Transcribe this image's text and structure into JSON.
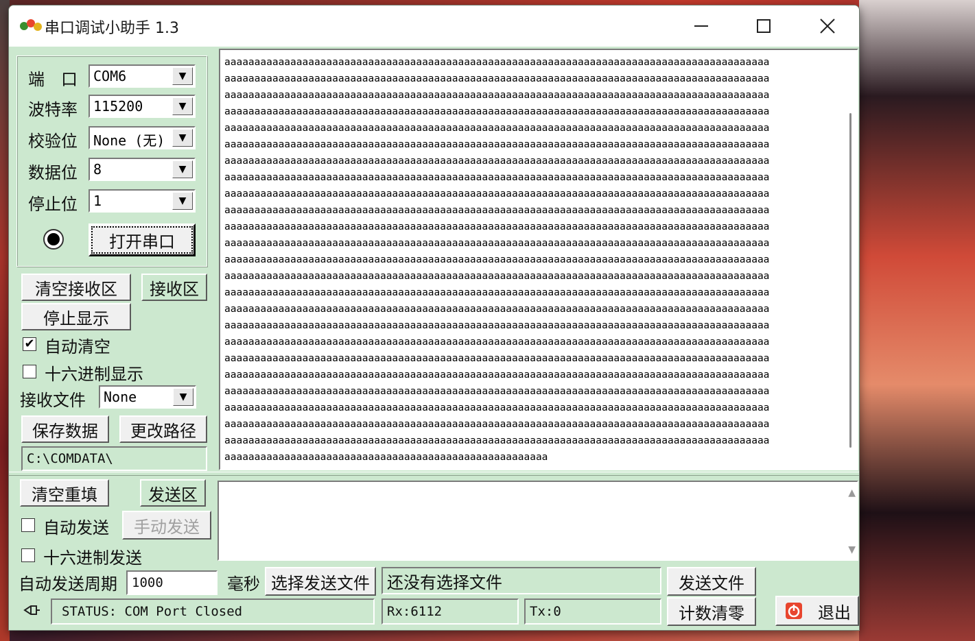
{
  "window": {
    "title": "串口调试小助手 1.3"
  },
  "settings": {
    "port_label": "端　口",
    "port_value": "COM6",
    "baud_label": "波特率",
    "baud_value": "115200",
    "parity_label": "校验位",
    "parity_value": "None (无)",
    "databits_label": "数据位",
    "databits_value": "8",
    "stopbits_label": "停止位",
    "stopbits_value": "1",
    "open_port_label": "打开串口"
  },
  "receive": {
    "clear_label": "清空接收区",
    "area_label": "接收区",
    "stop_display_label": "停止显示",
    "auto_clear_label": "自动清空",
    "auto_clear_checked": true,
    "hex_display_label": "十六进制显示",
    "hex_display_checked": false,
    "file_label": "接收文件",
    "file_value": "None",
    "save_label": "保存数据",
    "change_path_label": "更改路径",
    "path_value": "C:\\COMDATA\\",
    "lines": [
      "aaaaaaaaaaaaaaaaaaaaaaaaaaaaaaaaaaaaaaaaaaaaaaaaaaaaaaaaaaaaaaaaaaaaaaaaaaaaaaaaaaaaaaaaaaa",
      "aaaaaaaaaaaaaaaaaaaaaaaaaaaaaaaaaaaaaaaaaaaaaaaaaaaaaaaaaaaaaaaaaaaaaaaaaaaaaaaaaaaaaaaaaaa",
      "aaaaaaaaaaaaaaaaaaaaaaaaaaaaaaaaaaaaaaaaaaaaaaaaaaaaaaaaaaaaaaaaaaaaaaaaaaaaaaaaaaaaaaaaaaa",
      "aaaaaaaaaaaaaaaaaaaaaaaaaaaaaaaaaaaaaaaaaaaaaaaaaaaaaaaaaaaaaaaaaaaaaaaaaaaaaaaaaaaaaaaaaaa",
      "aaaaaaaaaaaaaaaaaaaaaaaaaaaaaaaaaaaaaaaaaaaaaaaaaaaaaaaaaaaaaaaaaaaaaaaaaaaaaaaaaaaaaaaaaaa",
      "aaaaaaaaaaaaaaaaaaaaaaaaaaaaaaaaaaaaaaaaaaaaaaaaaaaaaaaaaaaaaaaaaaaaaaaaaaaaaaaaaaaaaaaaaaa",
      "aaaaaaaaaaaaaaaaaaaaaaaaaaaaaaaaaaaaaaaaaaaaaaaaaaaaaaaaaaaaaaaaaaaaaaaaaaaaaaaaaaaaaaaaaaa",
      "aaaaaaaaaaaaaaaaaaaaaaaaaaaaaaaaaaaaaaaaaaaaaaaaaaaaaaaaaaaaaaaaaaaaaaaaaaaaaaaaaaaaaaaaaaa",
      "aaaaaaaaaaaaaaaaaaaaaaaaaaaaaaaaaaaaaaaaaaaaaaaaaaaaaaaaaaaaaaaaaaaaaaaaaaaaaaaaaaaaaaaaaaa",
      "aaaaaaaaaaaaaaaaaaaaaaaaaaaaaaaaaaaaaaaaaaaaaaaaaaaaaaaaaaaaaaaaaaaaaaaaaaaaaaaaaaaaaaaaaaa",
      "aaaaaaaaaaaaaaaaaaaaaaaaaaaaaaaaaaaaaaaaaaaaaaaaaaaaaaaaaaaaaaaaaaaaaaaaaaaaaaaaaaaaaaaaaaa",
      "aaaaaaaaaaaaaaaaaaaaaaaaaaaaaaaaaaaaaaaaaaaaaaaaaaaaaaaaaaaaaaaaaaaaaaaaaaaaaaaaaaaaaaaaaaa",
      "aaaaaaaaaaaaaaaaaaaaaaaaaaaaaaaaaaaaaaaaaaaaaaaaaaaaaaaaaaaaaaaaaaaaaaaaaaaaaaaaaaaaaaaaaaa",
      "aaaaaaaaaaaaaaaaaaaaaaaaaaaaaaaaaaaaaaaaaaaaaaaaaaaaaaaaaaaaaaaaaaaaaaaaaaaaaaaaaaaaaaaaaaa",
      "aaaaaaaaaaaaaaaaaaaaaaaaaaaaaaaaaaaaaaaaaaaaaaaaaaaaaaaaaaaaaaaaaaaaaaaaaaaaaaaaaaaaaaaaaaa",
      "aaaaaaaaaaaaaaaaaaaaaaaaaaaaaaaaaaaaaaaaaaaaaaaaaaaaaaaaaaaaaaaaaaaaaaaaaaaaaaaaaaaaaaaaaaa",
      "aaaaaaaaaaaaaaaaaaaaaaaaaaaaaaaaaaaaaaaaaaaaaaaaaaaaaaaaaaaaaaaaaaaaaaaaaaaaaaaaaaaaaaaaaaa",
      "aaaaaaaaaaaaaaaaaaaaaaaaaaaaaaaaaaaaaaaaaaaaaaaaaaaaaaaaaaaaaaaaaaaaaaaaaaaaaaaaaaaaaaaaaaa",
      "aaaaaaaaaaaaaaaaaaaaaaaaaaaaaaaaaaaaaaaaaaaaaaaaaaaaaaaaaaaaaaaaaaaaaaaaaaaaaaaaaaaaaaaaaaa",
      "aaaaaaaaaaaaaaaaaaaaaaaaaaaaaaaaaaaaaaaaaaaaaaaaaaaaaaaaaaaaaaaaaaaaaaaaaaaaaaaaaaaaaaaaaaa",
      "aaaaaaaaaaaaaaaaaaaaaaaaaaaaaaaaaaaaaaaaaaaaaaaaaaaaaaaaaaaaaaaaaaaaaaaaaaaaaaaaaaaaaaaaaaa",
      "aaaaaaaaaaaaaaaaaaaaaaaaaaaaaaaaaaaaaaaaaaaaaaaaaaaaaaaaaaaaaaaaaaaaaaaaaaaaaaaaaaaaaaaaaaa",
      "aaaaaaaaaaaaaaaaaaaaaaaaaaaaaaaaaaaaaaaaaaaaaaaaaaaaaaaaaaaaaaaaaaaaaaaaaaaaaaaaaaaaaaaaaaa",
      "aaaaaaaaaaaaaaaaaaaaaaaaaaaaaaaaaaaaaaaaaaaaaaaaaaaaaaaaaaaaaaaaaaaaaaaaaaaaaaaaaaaaaaaaaaa",
      "aaaaaaaaaaaaaaaaaaaaaaaaaaaaaaaaaaaaaaaaaaaaaaaaaaaaaa"
    ]
  },
  "send": {
    "clear_label": "清空重填",
    "area_label": "发送区",
    "auto_send_label": "自动发送",
    "auto_send_checked": false,
    "manual_send_label": "手动发送",
    "hex_send_label": "十六进制发送",
    "hex_send_checked": false,
    "period_label": "自动发送周期",
    "period_value": "1000",
    "ms_label": "毫秒",
    "choose_file_label": "选择发送文件",
    "file_status": "还没有选择文件",
    "send_file_label": "发送文件"
  },
  "status": {
    "text": "STATUS: COM Port Closed",
    "rx": "Rx:6112",
    "tx": "Tx:0",
    "reset_count_label": "计数清零",
    "exit_label": "退出"
  },
  "colors": {
    "panel": "#cce8cf",
    "exit_icon": "#e8452e"
  }
}
